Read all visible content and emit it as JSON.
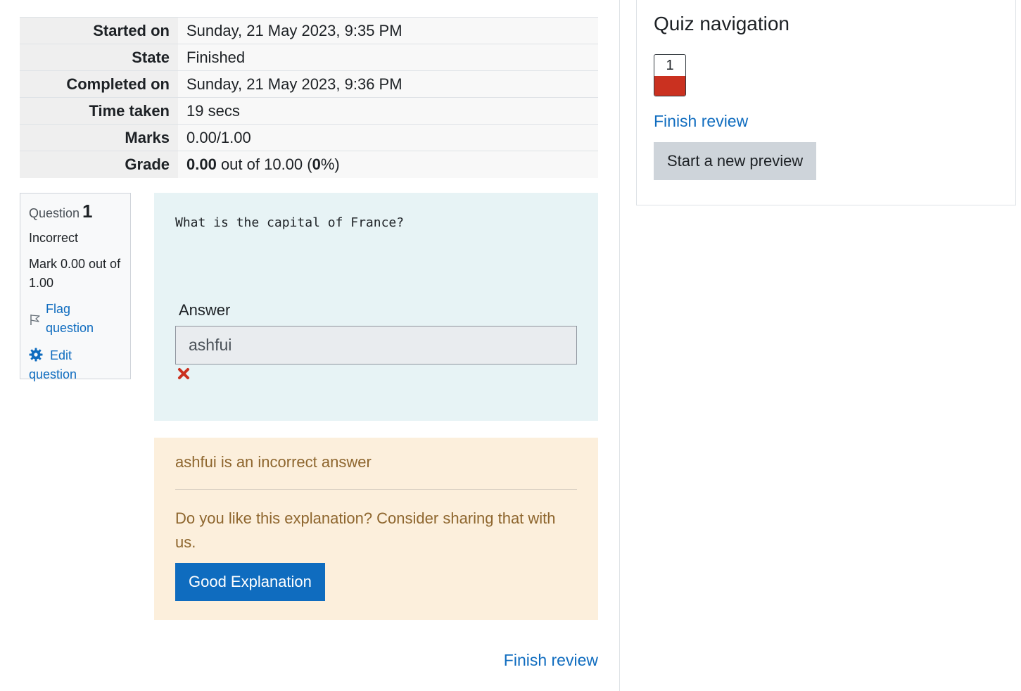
{
  "summary": {
    "rows": [
      {
        "label": "Started on",
        "value": "Sunday, 21 May 2023, 9:35 PM"
      },
      {
        "label": "State",
        "value": "Finished"
      },
      {
        "label": "Completed on",
        "value": "Sunday, 21 May 2023, 9:36 PM"
      },
      {
        "label": "Time taken",
        "value": "19 secs"
      },
      {
        "label": "Marks",
        "value": "0.00/1.00"
      }
    ],
    "grade": {
      "label": "Grade",
      "score": "0.00",
      "out_of_text": " out of 10.00 (",
      "percent": "0",
      "percent_suffix": "%)"
    }
  },
  "question_info": {
    "label": "Question",
    "number": "1",
    "state": "Incorrect",
    "mark": "Mark 0.00 out of 1.00",
    "flag_label": "Flag question",
    "edit_label": "Edit question"
  },
  "question": {
    "text": "What is the capital of France?",
    "answer_label": "Answer",
    "answer_value": "ashfui"
  },
  "feedback": {
    "text": "ashfui is an incorrect answer",
    "prompt": "Do you like this explanation? Consider sharing that with us.",
    "button_label": "Good Explanation"
  },
  "finish_review_bottom": "Finish review",
  "quiz_navigation": {
    "title": "Quiz navigation",
    "buttons": [
      {
        "number": "1",
        "status": "incorrect"
      }
    ],
    "finish_review": "Finish review",
    "new_preview_label": "Start a new preview"
  },
  "colors": {
    "link": "#0f6cbf",
    "incorrect": "#ca3120",
    "feedback_text": "#8e662e",
    "feedback_bg": "#fcefdc",
    "formulation_bg": "#e7f3f5"
  },
  "icons": {
    "flag": "flag-icon",
    "edit": "gear-icon",
    "incorrect": "cross-icon"
  }
}
